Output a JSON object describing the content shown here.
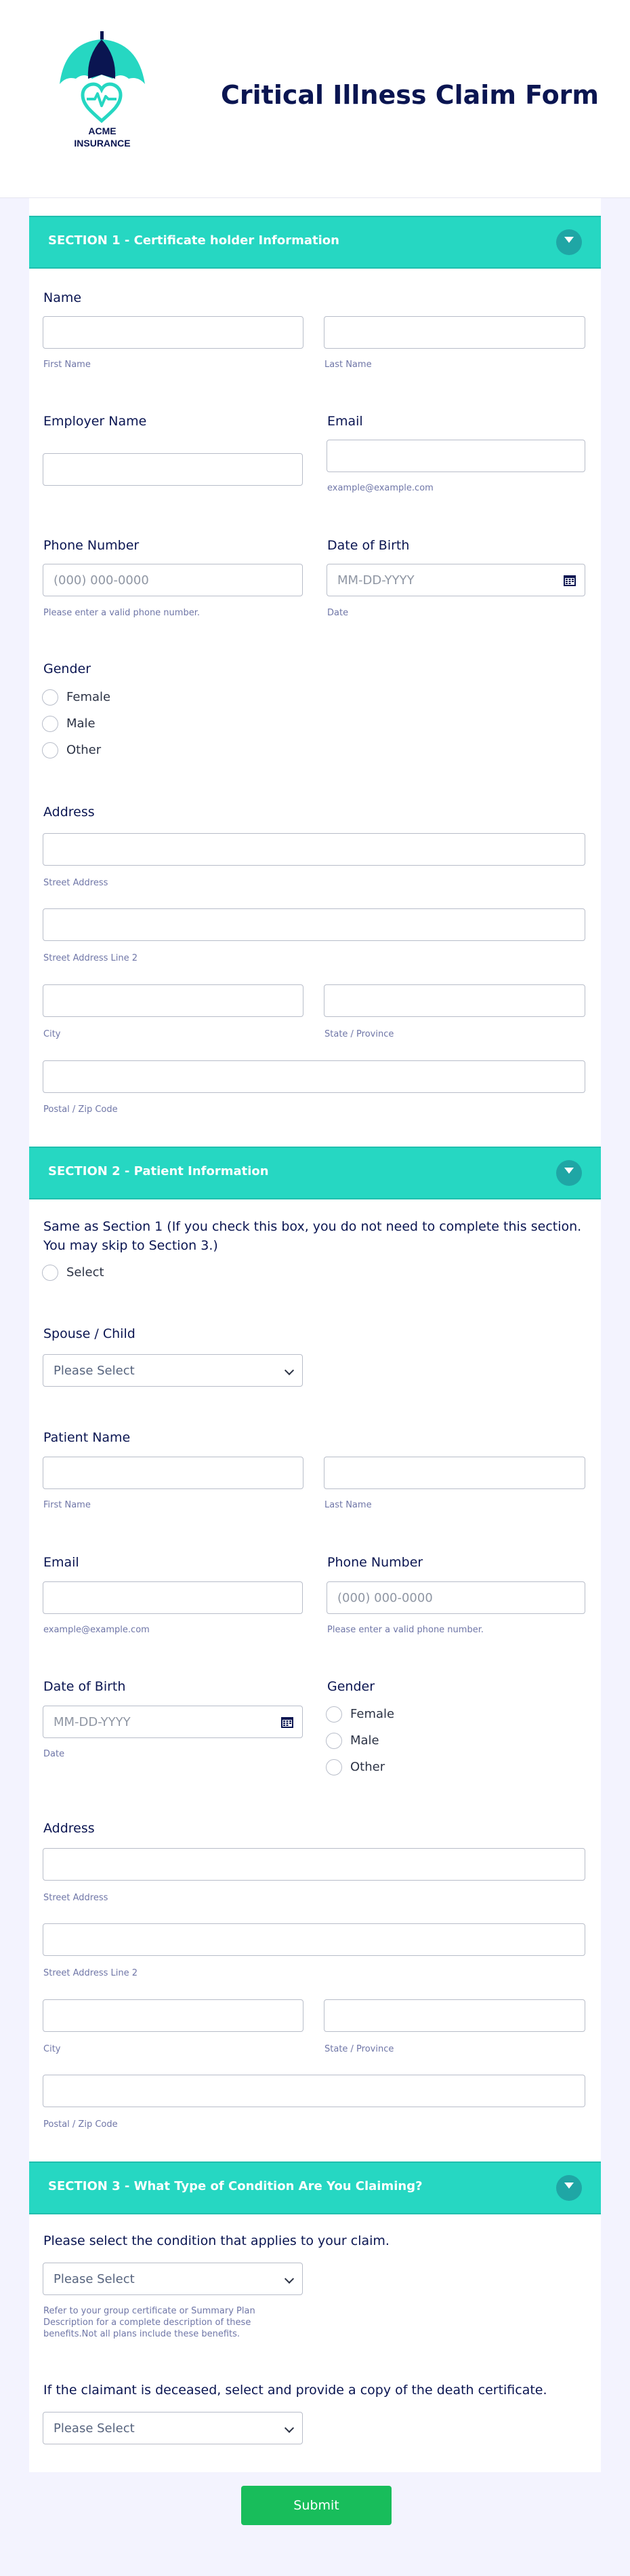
{
  "logo": {
    "text_line1": "ACME",
    "text_line2": "INSURANCE",
    "colors": {
      "umbrella_teal": "#26d7c2",
      "umbrella_navy": "#0a1551",
      "heart": "#26d7c2"
    }
  },
  "header": {
    "title": "Critical Illness Claim Form"
  },
  "colors": {
    "section_bg": "#26d7c2",
    "submit_bg": "#18bd5b",
    "label": "#0a1551",
    "background": "#f3f3fe"
  },
  "section1": {
    "title": "SECTION 1 - Certificate holder Information",
    "name": {
      "label": "Name",
      "first_sub": "First Name",
      "last_sub": "Last Name"
    },
    "employer": {
      "label": "Employer Name"
    },
    "email": {
      "label": "Email",
      "sub": "example@example.com"
    },
    "phone": {
      "label": "Phone Number",
      "placeholder": "(000) 000-0000",
      "sub": "Please enter a valid phone number."
    },
    "dob": {
      "label": "Date of Birth",
      "placeholder": "MM-DD-YYYY",
      "sub": "Date"
    },
    "gender": {
      "label": "Gender",
      "options": [
        "Female",
        "Male",
        "Other"
      ]
    },
    "address": {
      "label": "Address",
      "street": "Street Address",
      "street2": "Street Address Line 2",
      "city": "City",
      "state": "State / Province",
      "postal": "Postal / Zip Code"
    }
  },
  "section2": {
    "title": "SECTION 2 - Patient Information",
    "same": {
      "label": "Same as Section 1 (If you check this box, you do not need to complete this section. You may skip to Section 3.)",
      "option": "Select"
    },
    "spouse": {
      "label": "Spouse / Child",
      "placeholder": "Please Select"
    },
    "patient_name": {
      "label": "Patient Name",
      "first_sub": "First Name",
      "last_sub": "Last Name"
    },
    "email": {
      "label": "Email",
      "sub": "example@example.com"
    },
    "phone": {
      "label": "Phone Number",
      "placeholder": "(000) 000-0000",
      "sub": "Please enter a valid phone number."
    },
    "dob": {
      "label": "Date of Birth",
      "placeholder": "MM-DD-YYYY",
      "sub": "Date"
    },
    "gender": {
      "label": "Gender",
      "options": [
        "Female",
        "Male",
        "Other"
      ]
    },
    "address": {
      "label": "Address",
      "street": "Street Address",
      "street2": "Street Address Line 2",
      "city": "City",
      "state": "State / Province",
      "postal": "Postal / Zip Code"
    }
  },
  "section3": {
    "title": "SECTION 3 - What Type of Condition Are You Claiming?",
    "condition": {
      "label": "Please select the condition that applies to your claim.",
      "placeholder": "Please Select",
      "sub": "Refer to your group certificate or Summary Plan Description for a complete description of these benefits.Not all plans include these benefits."
    },
    "deceased": {
      "label": "If the claimant is deceased, select and provide a copy of the death certificate.",
      "placeholder": "Please Select"
    }
  },
  "submit": {
    "label": "Submit"
  }
}
